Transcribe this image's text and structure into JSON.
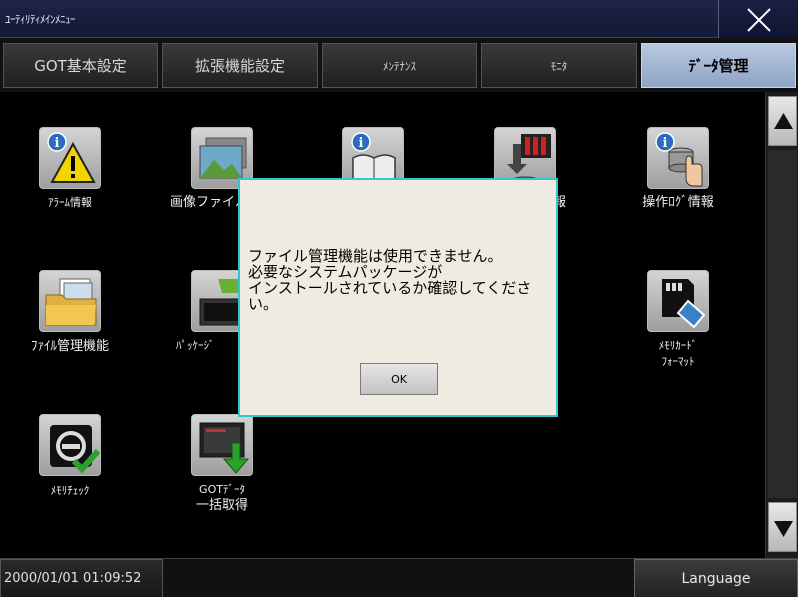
{
  "window": {
    "title": "ﾕｰﾃｨﾘﾃｨﾒｲﾝﾒﾆｭｰ"
  },
  "tabs": [
    {
      "label": "GOT基本設定"
    },
    {
      "label": "拡張機能設定"
    },
    {
      "label": "ﾒﾝﾃﾅﾝｽ"
    },
    {
      "label": "ﾓﾆﾀ"
    },
    {
      "label": "ﾃﾞｰﾀ管理",
      "active": true
    }
  ],
  "items": [
    {
      "label": "ｱﾗｰﾑ情報",
      "icon": "alarm-info-icon"
    },
    {
      "label": "画像ファイル",
      "icon": "image-file-icon"
    },
    {
      "label": "",
      "icon": "resource-info-icon"
    },
    {
      "label": "報",
      "icon": "data-transfer-icon"
    },
    {
      "label": "操作ﾛｸﾞ情報",
      "icon": "operation-log-icon"
    },
    {
      "label": "ﾌｧｲﾙ管理機能",
      "icon": "file-manager-icon"
    },
    {
      "label": "ﾊﾟｯｹｰｼﾞ",
      "icon": "package-icon"
    },
    {
      "label": "ﾒﾓﾘｶｰﾄﾞ",
      "label2": "ﾌｫｰﾏｯﾄ",
      "icon": "memory-card-format-icon"
    },
    {
      "label": "ﾒﾓﾘﾁｪｯｸ",
      "icon": "memory-check-icon"
    },
    {
      "label": "GOTﾃﾞｰﾀ",
      "label2": "一括取得",
      "icon": "got-data-batch-icon"
    }
  ],
  "dialog": {
    "line1": "ファイル管理機能は使用できません。",
    "line2": "必要なシステムパッケージが",
    "line3": "インストールされているか確認してくださ",
    "line4": "い。",
    "ok_label": "OK"
  },
  "status": {
    "datetime": "2000/01/01 01:09:52",
    "language_label": "Language"
  },
  "colors": {
    "active_tab": "#a8bad6",
    "dialog_border": "#2fc8d0",
    "dialog_bg": "#efebe0"
  }
}
